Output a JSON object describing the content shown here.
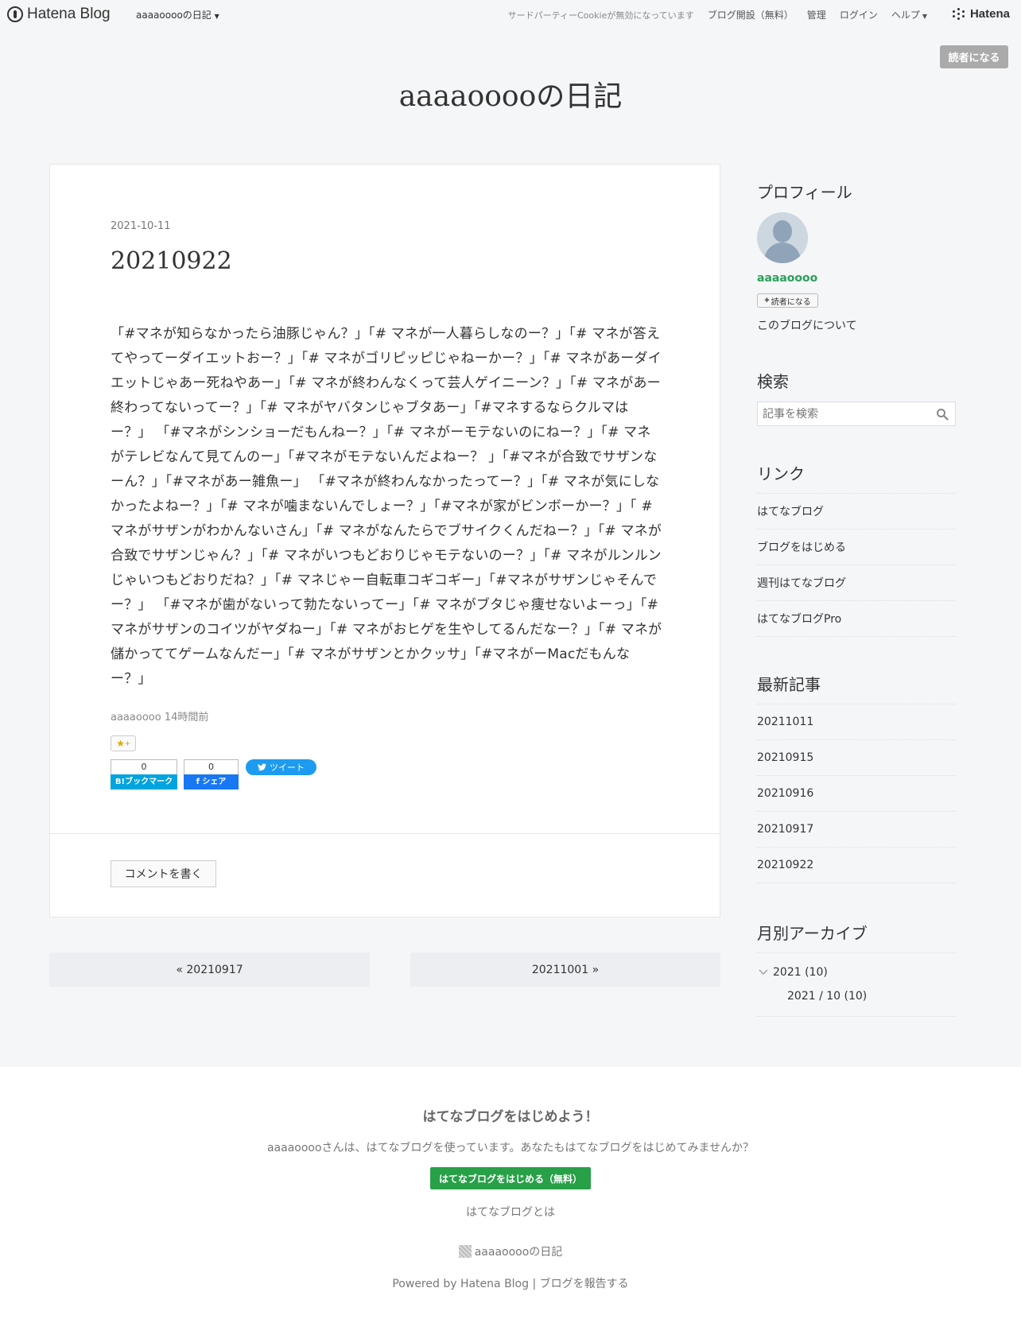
{
  "global_header": {
    "logo_text": "Hatena Blog",
    "blog_menu": "aaaaooooの日記",
    "cookie_notice": "サードパーティーCookieが無効になっています",
    "links": [
      "ブログ開設（無料）",
      "管理",
      "ログイン",
      "ヘルプ"
    ],
    "brand": "Hatena"
  },
  "subscribe_button": "読者になる",
  "blog_title": "aaaaooooの日記",
  "entry": {
    "date": "2021-10-11",
    "title": "20210922",
    "body": "「#マネが知らなかったら油豚じゃん？」「# マネが一人暮らしなのー？」「# マネが答えてやってーダイエットおー？」「# マネがゴリピッピじゃねーかー？」「# マネがあーダイエットじゃあー死ねやあー」「# マネが終わんなくって芸人ゲイニーン？」「# マネがあー終わってないってー？」「# マネがヤバタンじゃブタあー」「#マネするならクルマはー？」 「#マネがシンショーだもんねー？」「# マネがーモテないのにねー？」「# マネがテレビなんて見てんのー」「#マネがモテないんだよねー？ 」「#マネが合致でサザンなーん？」「#マネがあー雑魚ー」 「#マネが終わんなかったってー？」「# マネが気にしなかったよねー？」「# マネが噛まないんでしょー？」「#マネが家がビンボーかー？」「 #マネがサザンがわかんないさん」「# マネがなんたらでブサイクくんだねー？」「# マネが合致でサザンじゃん？」「# マネがいつもどおりじゃモテないのー？」「# マネがルンルンじゃいつもどおりだね？」「# マネじゃー自転車コギコギー」「#マネがサザンじゃそんでー？」 「#マネが歯がないって勃たないってー」「# マネがブタじゃ痩せないよーっ」「# マネがサザンのコイツがヤダねー」「# マネがおヒゲを生やしてるんだなー？」「# マネが儲かっててゲームなんだー」「# マネがサザンとかクッサ」「#マネがーMacだもんなー？」",
    "footer": "aaaaoooo 14時間前",
    "star_label": "★+",
    "bookmark_count": "0",
    "bookmark_label": "B!ブックマーク",
    "facebook_count": "0",
    "facebook_label": "f シェア",
    "tweet_label": "ツイート",
    "comment_button": "コメントを書く"
  },
  "pager": {
    "prev": "« 20210917",
    "next": "20211001 »"
  },
  "sidebar": {
    "profile": {
      "heading": "プロフィール",
      "name": "aaaaoooo",
      "subscribe": "読者になる",
      "about": "このブログについて"
    },
    "search": {
      "heading": "検索",
      "placeholder": "記事を検索"
    },
    "links": {
      "heading": "リンク",
      "items": [
        "はてなブログ",
        "ブログをはじめる",
        "週刊はてなブログ",
        "はてなブログPro"
      ]
    },
    "recent": {
      "heading": "最新記事",
      "items": [
        "20211011",
        "20210915",
        "20210916",
        "20210917",
        "20210922"
      ]
    },
    "archive": {
      "heading": "月別アーカイブ",
      "year": "2021 (10)",
      "month": "2021 / 10 (10)"
    }
  },
  "footer": {
    "title": "はてなブログをはじめよう！",
    "description": "aaaaooooさんは、はてなブログを使っています。あなたもはてなブログをはじめてみませんか？",
    "start_button": "はてなブログをはじめる（無料）",
    "what": "はてなブログとは",
    "blog_name": "aaaaooooの日記",
    "powered": "Powered by Hatena Blog",
    "report": "ブログを報告する",
    "separator": "|"
  }
}
